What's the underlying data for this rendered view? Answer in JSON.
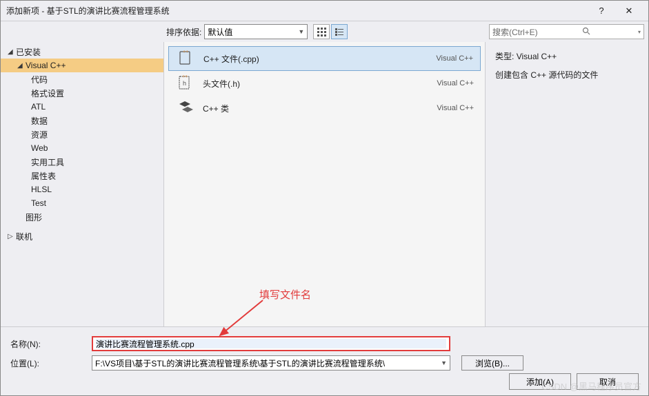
{
  "title": "添加新项 - 基于STL的演讲比赛流程管理系统",
  "winbuttons": {
    "help": "?",
    "close": "✕"
  },
  "toolbar": {
    "sort_label": "排序依据:",
    "sort_value": "默认值"
  },
  "search": {
    "placeholder": "搜索(Ctrl+E)"
  },
  "tree": {
    "installed": "已安装",
    "vcpp": "Visual C++",
    "code": "代码",
    "format": "格式设置",
    "atl": "ATL",
    "data": "数据",
    "resource": "资源",
    "web": "Web",
    "utils": "实用工具",
    "props": "属性表",
    "hlsl": "HLSL",
    "test": "Test",
    "graphics": "图形",
    "online": "联机"
  },
  "list": {
    "items": [
      {
        "name": "C++ 文件(.cpp)",
        "lang": "Visual C++"
      },
      {
        "name": "头文件(.h)",
        "lang": "Visual C++"
      },
      {
        "name": "C++ 类",
        "lang": "Visual C++"
      }
    ]
  },
  "details": {
    "type_label": "类型:",
    "type_value": "Visual C++",
    "description": "创建包含 C++ 源代码的文件"
  },
  "form": {
    "name_label": "名称(N):",
    "name_value": "演讲比赛流程管理系统.cpp",
    "location_label": "位置(L):",
    "location_value": "F:\\VS项目\\基于STL的演讲比赛流程管理系统\\基于STL的演讲比赛流程管理系统\\",
    "browse": "浏览(B)..."
  },
  "buttons": {
    "add": "添加(A)",
    "cancel": "取消"
  },
  "annotation": "填写文件名",
  "watermark": "CSDN @黑马程序员官方"
}
